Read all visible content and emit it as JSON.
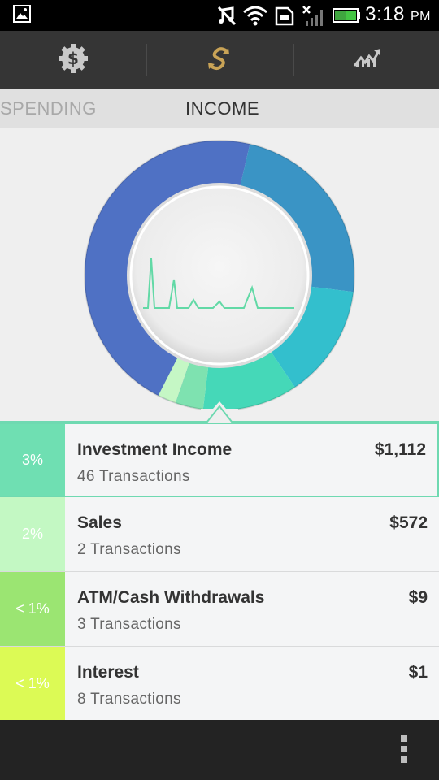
{
  "status_bar": {
    "time": "3:18",
    "ampm": "PM"
  },
  "toolbar": {
    "items": [
      {
        "icon": "dollar-gear-icon",
        "active": false
      },
      {
        "icon": "refresh-s-icon",
        "active": true
      },
      {
        "icon": "trend-chart-icon",
        "active": false
      }
    ]
  },
  "tabs": {
    "spending": "SPENDING",
    "income": "INCOME",
    "selected": "INCOME"
  },
  "chart_data": {
    "type": "pie",
    "categories": [
      "Investment Income",
      "Sales",
      "ATM/Cash Withdrawals",
      "Interest"
    ],
    "visible_slices": [
      {
        "color": "#4f71c4"
      },
      {
        "color": "#3a94c5"
      },
      {
        "color": "#33bfcd"
      },
      {
        "color": "#45d8b8"
      },
      {
        "color": "#7ee2b0"
      },
      {
        "color": "#c5f7c5"
      }
    ],
    "highlighted": "Investment Income"
  },
  "rows": [
    {
      "percent": "3%",
      "name": "Investment Income",
      "transactions": "46 Transactions",
      "amount": "$1,112",
      "color": "#6fdfb2",
      "selected": true
    },
    {
      "percent": "2%",
      "name": "Sales",
      "transactions": "2 Transactions",
      "amount": "$572",
      "color": "#c3f8c3",
      "selected": false
    },
    {
      "percent": "< 1%",
      "name": "ATM/Cash Withdrawals",
      "transactions": "3 Transactions",
      "amount": "$9",
      "color": "#9be572",
      "selected": false
    },
    {
      "percent": "< 1%",
      "name": "Interest",
      "transactions": "8 Transactions",
      "amount": "$1",
      "color": "#dcfa55",
      "selected": false
    }
  ]
}
